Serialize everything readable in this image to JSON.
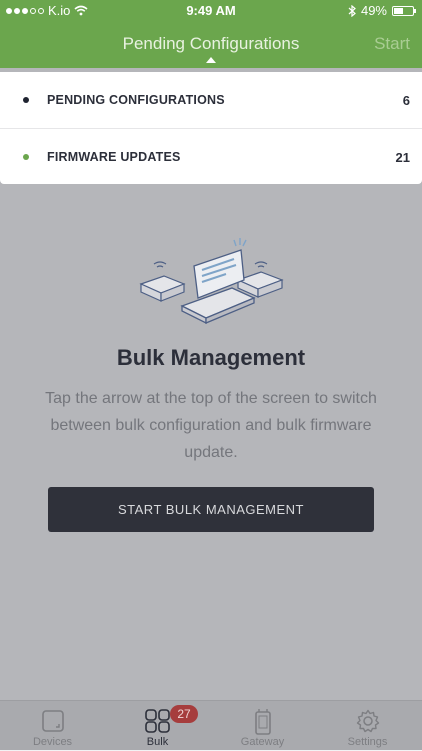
{
  "status_bar": {
    "carrier": "K.io",
    "time": "9:49 AM",
    "battery": "49%"
  },
  "nav": {
    "title": "Pending Configurations",
    "start_label": "Start"
  },
  "dropdown": {
    "items": [
      {
        "label": "PENDING CONFIGURATIONS",
        "count": "6",
        "bullet_color": "#1f2330"
      },
      {
        "label": "FIRMWARE UPDATES",
        "count": "21",
        "bullet_color": "#6ba64d"
      }
    ]
  },
  "content": {
    "illustration_icon": "bulk-management-illustration",
    "title": "Bulk Management",
    "description": "Tap the arrow at the top of the screen to switch between bulk configuration and bulk firmware update.",
    "button_label": "START BULK MANAGEMENT"
  },
  "tabbar": {
    "tabs": [
      {
        "label": "Devices",
        "icon": "device-icon"
      },
      {
        "label": "Bulk",
        "icon": "grid-icon",
        "active": true
      },
      {
        "label": "Gateway",
        "icon": "gateway-icon"
      },
      {
        "label": "Settings",
        "icon": "gear-icon"
      }
    ],
    "badge": "27"
  },
  "colors": {
    "header_green": "#6ba64d",
    "dark": "#2f313a",
    "badge_red": "#a63d3d"
  }
}
